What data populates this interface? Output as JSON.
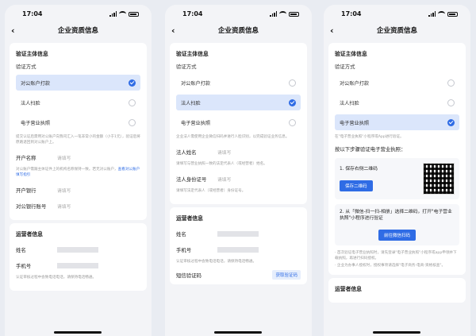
{
  "status_time": "17:04",
  "nav_title": "企业资质信息",
  "section_title": "验证主体信息",
  "method_label": "验证方式",
  "options": [
    "对公账户打款",
    "法人扫脸",
    "电子营业执照"
  ],
  "screen1": {
    "hint": "提交认证后需用对公账户向我司汇入一笔非常小的金额（小于1元），验证后将原路退回到对公账户上。",
    "account_name_label": "开户名称",
    "placeholder": "请填写",
    "account_hint_text": "对公账户需跟主体证件上的机构名称保持一致。若无对公账户，",
    "account_hint_link": "查看对公账户填写指引",
    "bank_label": "开户银行",
    "account_no_label": "对公银行账号",
    "operator_title": "运营者信息",
    "name_label": "姓名",
    "phone_label": "手机号",
    "bottom_hint": "认证审核过程中会致电话电话，请保持电话畅通。"
  },
  "screen2": {
    "hint": "企业法人需使用企业微信扫码并进行人脸识别，以完成验证业务信息。",
    "legal_name_label": "法人姓名",
    "placeholder": "请填写",
    "legal_name_hint": "请填写与营业执照一致的法定代表人（或经营者）姓名。",
    "legal_id_label": "法人身份证号",
    "legal_id_hint": "请填写法定代表人（或经营者）身份证号。",
    "operator_title": "运营者信息",
    "name_label": "姓名",
    "phone_label": "手机号",
    "bottom_hint": "认证审核过程中会致电话电话，请保持电话畅通。",
    "sms_label": "短信验证码",
    "sms_button": "获取验证码"
  },
  "screen3": {
    "hint": "在\"电子营业执照\"小程序或App进行验证。",
    "steps_title": "按以下步骤验证电子营业执照：",
    "step1": "1. 保存右侧二维码",
    "step1_button": "保存二维码",
    "step2": "2. 从「微信-扫一扫-相册」选择二维码，打开\"电子营业执照\"小程序进行验证",
    "step2_button": "前往微信扫码",
    "note1": "· 首次验证电子营业执照时，请先登录\"电子营业执照\"小程序或app申领并下载执照，再进行扫码授权。",
    "note2": "· 企业为办事人授权时，授权事项请选择\"电子商务-电商-资格核查\"。",
    "operator_title": "运营者信息"
  }
}
